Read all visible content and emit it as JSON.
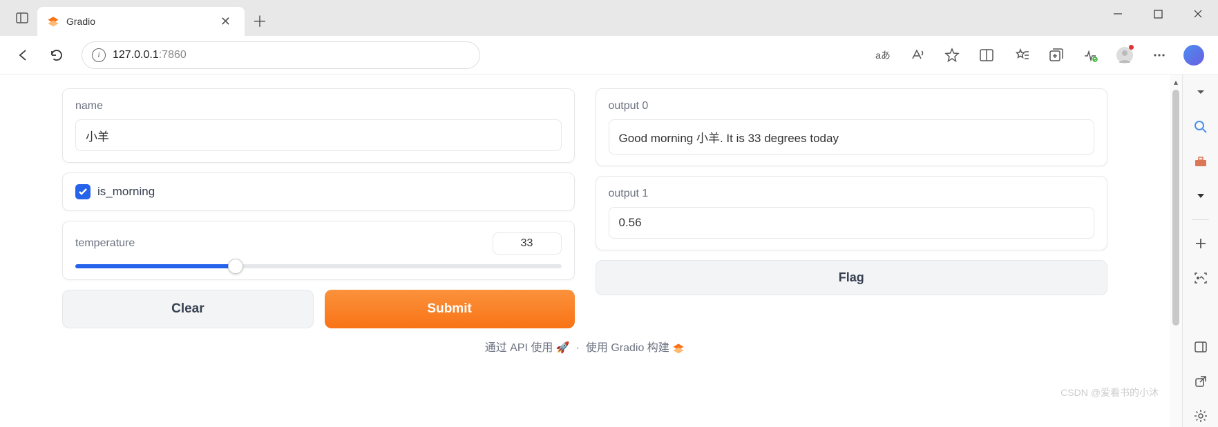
{
  "browser": {
    "tab_title": "Gradio",
    "url_host": "127.0.0.1",
    "url_port": ":7860",
    "translate_label": "aあ"
  },
  "inputs": {
    "name_label": "name",
    "name_value": "小羊",
    "is_morning_label": "is_morning",
    "temperature_label": "temperature",
    "temperature_value": "33",
    "temperature_percent": 33
  },
  "buttons": {
    "clear": "Clear",
    "submit": "Submit",
    "flag": "Flag"
  },
  "outputs": {
    "out0_label": "output 0",
    "out0_value": "Good morning 小羊. It is 33 degrees today",
    "out1_label": "output 1",
    "out1_value": "0.56"
  },
  "footer": {
    "api_text": "通过 API 使用",
    "sep": "·",
    "built_text": "使用 Gradio 构建"
  },
  "watermark": "CSDN @爱看书的小沐"
}
